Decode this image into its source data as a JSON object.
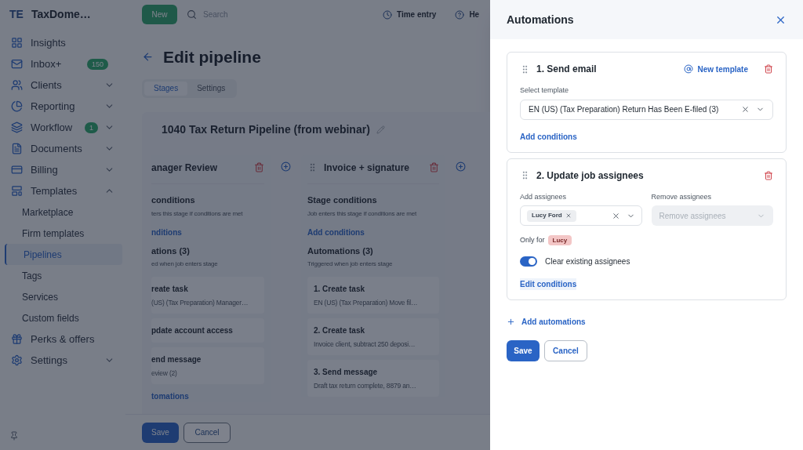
{
  "topbar": {
    "brand_initials": "TE",
    "brand_name": "TaxDome…",
    "new_button": "New",
    "search_placeholder": "Search",
    "time_entry": "Time entry",
    "help": "He"
  },
  "sidebar": {
    "items": [
      {
        "label": "Insights",
        "selected": false
      },
      {
        "label": "Inbox+",
        "selected": false,
        "badge": "150"
      },
      {
        "label": "Clients",
        "selected": false,
        "expanded": false
      },
      {
        "label": "Reporting",
        "selected": false,
        "expanded": false
      },
      {
        "label": "Workflow",
        "selected": false,
        "badge": "1",
        "expanded": false
      },
      {
        "label": "Documents",
        "selected": false,
        "expanded": false
      },
      {
        "label": "Billing",
        "selected": false,
        "expanded": false
      },
      {
        "label": "Templates",
        "selected": false,
        "expanded": true,
        "children": [
          {
            "label": "Marketplace",
            "selected": false
          },
          {
            "label": "Firm templates",
            "selected": false
          },
          {
            "label": "Pipelines",
            "selected": true
          },
          {
            "label": "Tags",
            "selected": false
          },
          {
            "label": "Services",
            "selected": false
          },
          {
            "label": "Custom fields",
            "selected": false
          }
        ]
      },
      {
        "label": "Perks & offers",
        "selected": false
      },
      {
        "label": "Settings",
        "selected": false,
        "expanded": false
      }
    ]
  },
  "page": {
    "title": "Edit pipeline",
    "tabs": [
      {
        "label": "Stages",
        "selected": true
      },
      {
        "label": "Settings",
        "selected": false
      }
    ],
    "pipeline_name": "1040 Tax Return Pipeline (from webinar)",
    "stages": [
      {
        "title": "anager Review",
        "handle": false,
        "conditions_heading": "conditions",
        "conditions_text": "ters this stage if conditions are met",
        "conditions_link": "nditions",
        "automations_heading": "ations (3)",
        "automations_text": "ed when job enters stage",
        "automations": [
          {
            "title": "reate task",
            "detail": "(US) (Tax Preparation) Manager…"
          },
          {
            "title": "pdate account access"
          },
          {
            "title": "end message",
            "detail": "eview (2)"
          }
        ],
        "automations_link": "tomations"
      },
      {
        "title": "Invoice + signature",
        "handle": true,
        "conditions_heading": "Stage conditions",
        "conditions_text": "Job enters this stage if conditions are met",
        "conditions_link": "Add conditions",
        "automations_heading": "Automations (3)",
        "automations_text": "Triggered when job enters stage",
        "automations": [
          {
            "title": "1. Create task",
            "detail": "EN (US) (Tax Preparation) Move fil…"
          },
          {
            "title": "2. Create task",
            "detail": "Invoice client, subtract 250 deposi…"
          },
          {
            "title": "3. Send message",
            "detail": "Draft tax return complete, 8879 an…"
          }
        ]
      }
    ],
    "footer": {
      "save": "Save",
      "cancel": "Cancel"
    }
  },
  "drawer": {
    "title": "Automations",
    "automations": [
      {
        "kind": "send_email",
        "title": "1. Send email",
        "new_template": "New template",
        "field_label": "Select template",
        "value": "EN (US) (Tax Preparation) Return Has Been E-filed (3)",
        "link": "Add conditions"
      },
      {
        "kind": "update_assignees",
        "title": "2. Update job assignees",
        "add_label": "Add assignees",
        "add_tags": [
          "Lucy Ford"
        ],
        "remove_label": "Remove assignees",
        "remove_placeholder": "Remove assignees",
        "remove_disabled": true,
        "only_for_label": "Only for",
        "only_for_tag": "Lucy",
        "toggle_label": "Clear existing assignees",
        "toggle_on": true,
        "link": "Edit conditions"
      }
    ],
    "add_automations": "Add automations",
    "save": "Save",
    "cancel": "Cancel"
  }
}
